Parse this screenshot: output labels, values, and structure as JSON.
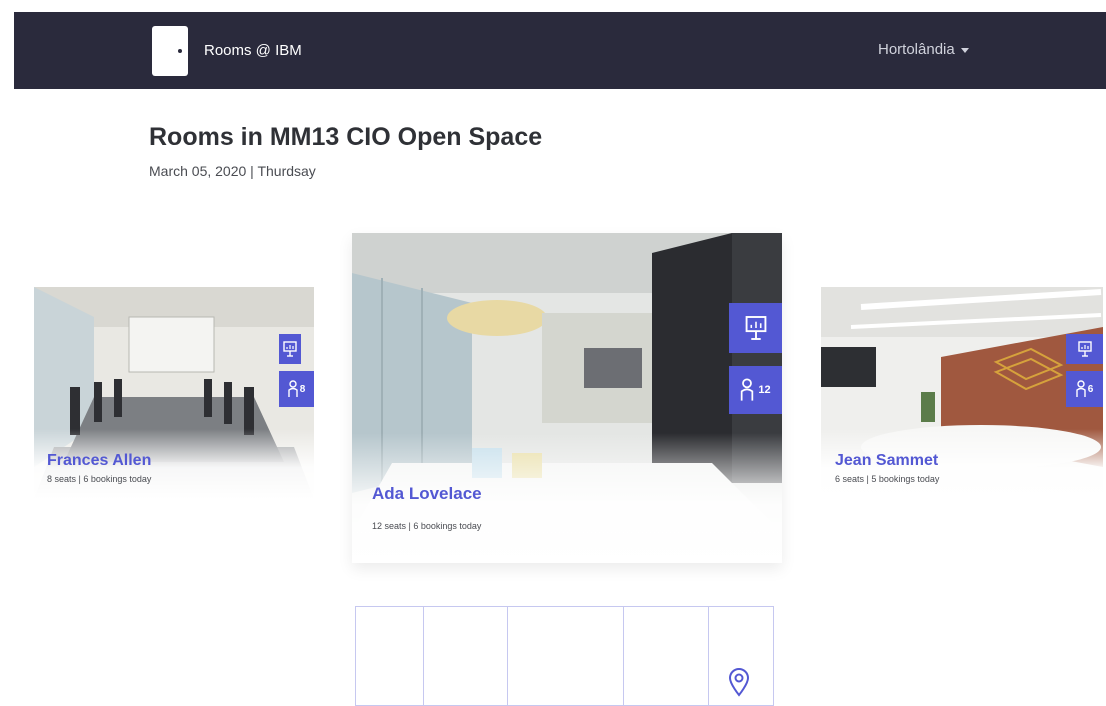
{
  "header": {
    "brand": "Rooms @ IBM",
    "location": "Hortolândia"
  },
  "page": {
    "title": "Rooms in MM13 CIO Open Space",
    "date": "March 05, 2020 | Thurdsay"
  },
  "rooms": [
    {
      "name": "Frances Allen",
      "meta": "8 seats | 6 bookings today",
      "seats": "8"
    },
    {
      "name": "Ada Lovelace",
      "meta": "12 seats | 6 bookings today",
      "seats": "12"
    },
    {
      "name": "Jean Sammet",
      "meta": "6 seats | 5 bookings today",
      "seats": "6"
    }
  ],
  "colors": {
    "header_bg": "#2a2a3c",
    "accent": "#5358d3",
    "floor_plan_line": "#c6c8f0"
  },
  "icons": [
    "presentation-board-icon",
    "person-icon",
    "map-pin-icon",
    "caret-down-icon"
  ]
}
